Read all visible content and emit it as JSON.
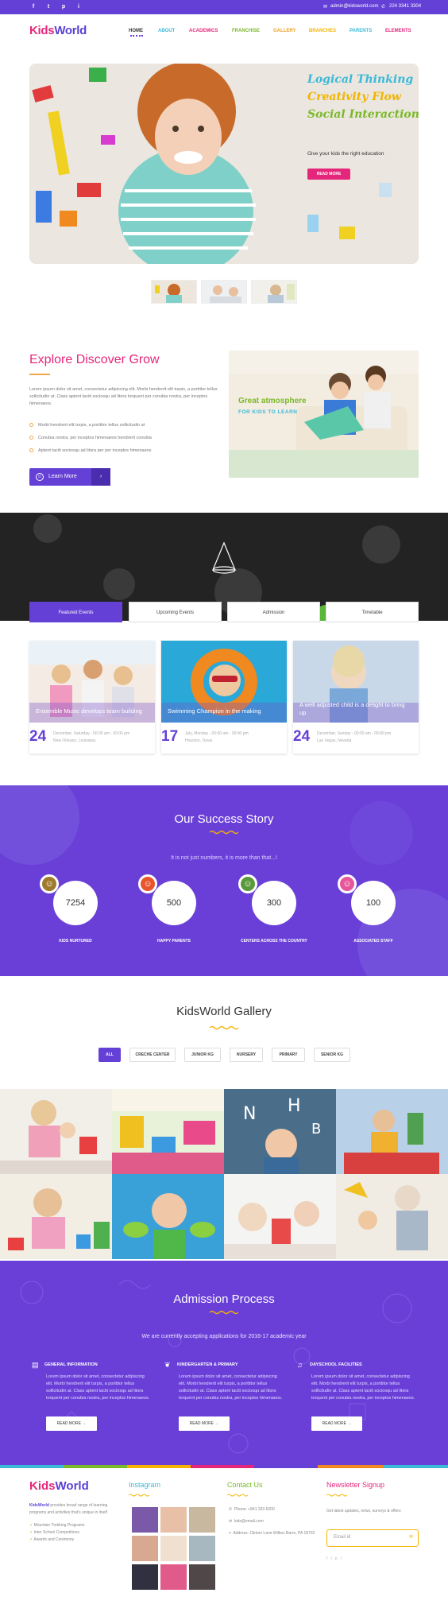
{
  "topbar": {
    "social": [
      "f",
      "t",
      "p",
      "i"
    ],
    "email": "admin@kidsworld.com",
    "phone": "224 3341 3304"
  },
  "brand": {
    "part1": "Kids",
    "part2": "World"
  },
  "nav": [
    "HOME",
    "ABOUT",
    "ACADEMICS",
    "FRANCHISE",
    "GALLERY",
    "BRANCHES",
    "PARENTS",
    "ELEMENTS"
  ],
  "hero": {
    "lines": [
      "Logical Thinking",
      "Creativity Flow",
      "Social Interactions"
    ],
    "tagline": "Give your kids the right education",
    "button": "READ MORE"
  },
  "explore": {
    "title": "Explore Discover Grow",
    "paragraph": "Lorem ipsum dolor sit amet, consectetur adipiscing elit. Morbi hendrerit elit turpis, a porttitor tellus sollicitudin at. Class aptent taciti sociosqu ad litora torquent per conubia nostra, per inceptos himenaeos.",
    "bullets": [
      "Morbi hendrerit elit turpis, a porttitor tellus sollicitudin at",
      "Conubia nostra, per inceptos himenaeos hendrerit conubia",
      "Aptent taciti sociosqu ad litora per per inceptos himenaeos"
    ],
    "button": "Learn More",
    "image_line1": "Great atmosphere",
    "image_line2": "FOR KIDS TO LEARN"
  },
  "tabs": [
    "Featured Events",
    "Upcoming Events",
    "Admission",
    "Timetable"
  ],
  "events": [
    {
      "caption": "Ensemble Music develops team building",
      "day": "24",
      "date": "December, Saturday - 00:00 am - 00:00 pm",
      "place": "New Orleans, Louisiana"
    },
    {
      "caption": "Swimming Champion in the making",
      "day": "17",
      "date": "July, Monday - 00:00 am - 00:00 pm",
      "place": "Houston, Texas"
    },
    {
      "caption": "A well adjusted child is a delight to bring up",
      "day": "24",
      "date": "December, Sunday - 00:00 am - 00:00 pm",
      "place": "Las Vegas, Nevada"
    }
  ],
  "success": {
    "title": "Our Success Story",
    "subtitle": "It is not just numbers, it is more than that...!",
    "stats": [
      {
        "value": "7254",
        "label": "KIDS NURTURED",
        "color": "#a07a2c"
      },
      {
        "value": "500",
        "label": "HAPPY PARENTS",
        "color": "#e8542c"
      },
      {
        "value": "300",
        "label": "CENTERS ACROSS THE COUNTRY",
        "color": "#5a9a3a"
      },
      {
        "value": "100",
        "label": "ASSOCIATED STAFF",
        "color": "#e8569a"
      }
    ]
  },
  "gallery": {
    "title": "KidsWorld Gallery",
    "filters": [
      "ALL",
      "CRECHE CENTER",
      "JUNIOR KG",
      "NURSERY",
      "PRIMARY",
      "SENIOR KG"
    ]
  },
  "admission": {
    "title": "Admission Process",
    "subtitle": "We are currently accepting applications for 2016-17 academic year",
    "columns": [
      {
        "title": "GENERAL INFORMATION",
        "text": "Lorem ipsum dolor sit amet, consectetur adipiscing elit. Morbi hendrerit elit turpis, a porttitor tellus sollicitudin at. Class aptent taciti sociosqu ad litora torquent per conubia nostra, per inceptos himenaeos.",
        "button": "READ MORE"
      },
      {
        "title": "KINDERGARTEN & PRIMARY",
        "text": "Lorem ipsum dolor sit amet, consectetur adipiscing elit. Morbi hendrerit elit turpis, a porttitor tellus sollicitudin at. Class aptent taciti sociosqu ad litora torquent per conubia nostra, per inceptos himenaeos.",
        "button": "READ MORE"
      },
      {
        "title": "DAYSCHOOL FACILITIES",
        "text": "Lorem ipsum dolor sit amet, consectetur adipiscing elit. Morbi hendrerit elit turpis, a porttitor tellus sollicitudin at. Class aptent taciti sociosqu ad litora torquent per conubia nostra, per inceptos himenaeos.",
        "button": "READ MORE"
      }
    ]
  },
  "footer": {
    "about_brand": "KidsWorld",
    "about": "provides broad range of learning programs and activities that's unique in itself",
    "list": [
      "Mountain Trekking Programs",
      "Inter School Competitions",
      "Awards and Ceremony"
    ],
    "instagram_title": "Instagram",
    "contact_title": "Contact Us",
    "phone": "Phone: +841 333 6200",
    "email": "kids@email.com",
    "address": "Address: Clinton Lane Wilkes Barre, PA 18702",
    "newsletter_title": "Newsletter Signup",
    "newsletter_text": "Get latest updates, news, surveys & offers",
    "email_placeholder": "Email id"
  }
}
